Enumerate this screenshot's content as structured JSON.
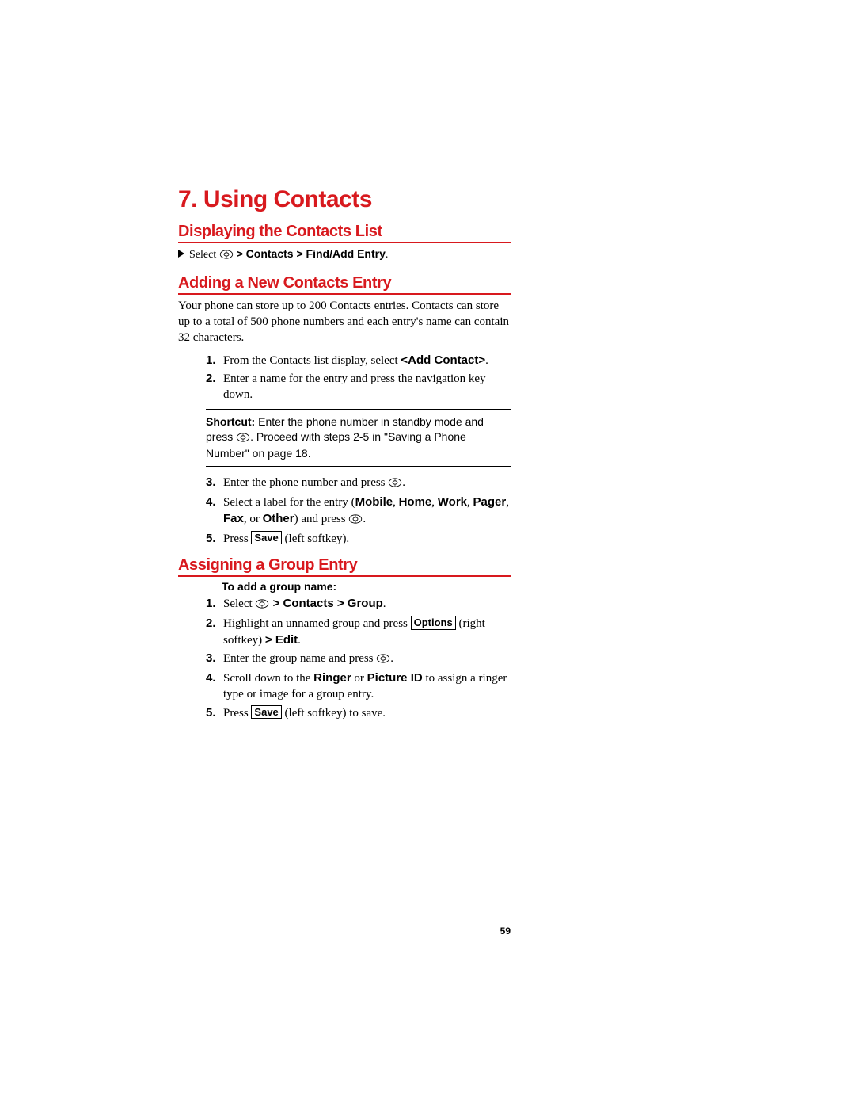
{
  "chapter_title": "7. Using Contacts",
  "section1": {
    "title": "Displaying the Contacts List",
    "select_prefix": "Select ",
    "select_path": " > Contacts > Find/Add Entry"
  },
  "section2": {
    "title": "Adding a New Contacts Entry",
    "intro": "Your phone can store up to 200 Contacts entries. Contacts can store up to a total of 500 phone numbers and each entry's name can contain 32 characters.",
    "step1_a": "From the Contacts list display, select ",
    "step1_b": "<Add Contact>",
    "step1_c": ".",
    "step2": "Enter a name for the entry and press the navigation key down.",
    "shortcut_label": "Shortcut: ",
    "shortcut_a": "Enter the phone number in standby mode and press ",
    "shortcut_b": ". Proceed with steps 2-5 in \"Saving a Phone Number\" on page 18.",
    "step3_a": "Enter the phone number and press ",
    "step3_b": ".",
    "step4_a": "Select a label for the entry (",
    "step4_labels": {
      "mobile": "Mobile",
      "home": "Home",
      "work": "Work",
      "pager": "Pager",
      "fax": "Fax",
      "other": "Other"
    },
    "step4_or": ", or ",
    "step4_b": ") and press ",
    "step4_c": ".",
    "step5_a": "Press ",
    "step5_save": "Save",
    "step5_b": " (left softkey)."
  },
  "section3": {
    "title": "Assigning a Group Entry",
    "subhead": "To add a group name:",
    "step1_a": "Select ",
    "step1_path": " > Contacts > Group",
    "step1_b": ".",
    "step2_a": "Highlight an unnamed group and press ",
    "step2_options": "Options",
    "step2_b": " (right softkey) ",
    "step2_edit": "> Edit",
    "step2_c": ".",
    "step3_a": "Enter the group name and press ",
    "step3_b": ".",
    "step4_a": "Scroll down to the ",
    "step4_ringer": "Ringer",
    "step4_or": " or ",
    "step4_pictureid": "Picture ID",
    "step4_b": " to assign a ringer type or image for a group entry.",
    "step5_a": "Press ",
    "step5_save": "Save",
    "step5_b": " (left softkey) to save."
  },
  "page_number": "59",
  "nums": {
    "n1": "1.",
    "n2": "2.",
    "n3": "3.",
    "n4": "4.",
    "n5": "5."
  },
  "sep": ", "
}
